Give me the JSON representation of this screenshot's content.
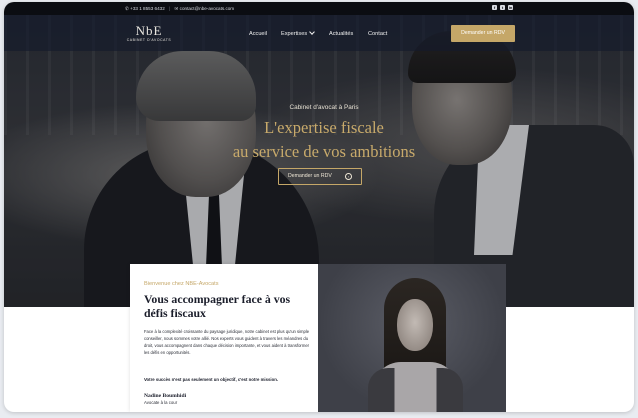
{
  "topbar": {
    "phone": "+33 1 8553 6432",
    "email": "contact@nbe-avocats.com",
    "social": [
      "facebook-icon",
      "twitter-icon",
      "linkedin-icon"
    ]
  },
  "nav": {
    "logo_mark": "NbE",
    "logo_sub": "CABINET D'AVOCATS",
    "items": [
      "Accueil",
      "Expertises",
      "Actualités",
      "Contact"
    ],
    "cta": "Demander un RDV"
  },
  "hero": {
    "eyebrow": "Cabinet d'avocat à Paris",
    "title_line1": "L'expertise fiscale",
    "title_line2": "au service de vos ambitions",
    "button": "Demander un RDV"
  },
  "welcome": {
    "eyebrow": "Bienvenue chez NBE-Avocats",
    "title": "Vous accompagner face à vos défis fiscaux",
    "body": "Face à la complexité croissante du paysage juridique, notre cabinet est plus qu'un simple conseiller, nous sommes votre allié. Nos experts vous guident à travers les méandres du droit, vous accompagnent dans chaque décision importante, et vous aident à transformer les défis en opportunités.",
    "strong": "Votre succès n'est pas seulement un objectif, c'est notre mission.",
    "name": "Nadine Boumhidi",
    "role": "Avocate à la cour"
  },
  "colors": {
    "accent_gold": "#c5a768",
    "nav_bg": "#141a2c",
    "text_dark": "#1a1d2a"
  }
}
